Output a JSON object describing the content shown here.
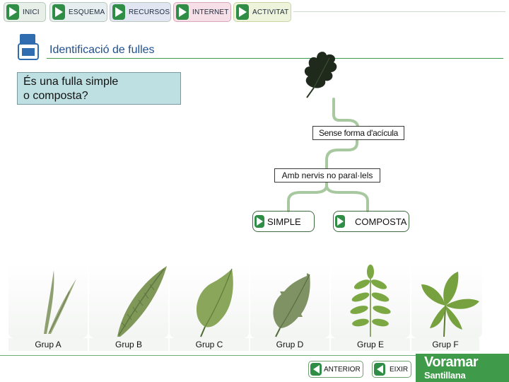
{
  "nav": {
    "items": [
      {
        "label": "INICI"
      },
      {
        "label": "ESQUEMA"
      },
      {
        "label": "RECURSOS"
      },
      {
        "label": "INTERNET"
      },
      {
        "label": "ACTIVITAT"
      }
    ]
  },
  "header": {
    "title": "Identificació de fulles"
  },
  "question": {
    "line1": "És una fulla simple",
    "line2": "o composta?"
  },
  "key": {
    "node1": "Sense forma d'acícula",
    "node2": "Amb nervis no paral·lels",
    "option_simple": "SIMPLE",
    "option_compound": "COMPOSTA"
  },
  "groups": [
    {
      "label": "Grup A"
    },
    {
      "label": "Grup B"
    },
    {
      "label": "Grup C"
    },
    {
      "label": "Grup D"
    },
    {
      "label": "Grup E"
    },
    {
      "label": "Grup F"
    }
  ],
  "footer": {
    "previous": "ANTERIOR",
    "exit": "EIXIR",
    "brand_line1": "Voramar",
    "brand_line2": "Santillana"
  },
  "colors": {
    "nav_green": "#2f8d46",
    "question_bg": "#bfe0e2",
    "tree_line": "#a8c9a0",
    "footer_green": "#3f9a4a"
  }
}
